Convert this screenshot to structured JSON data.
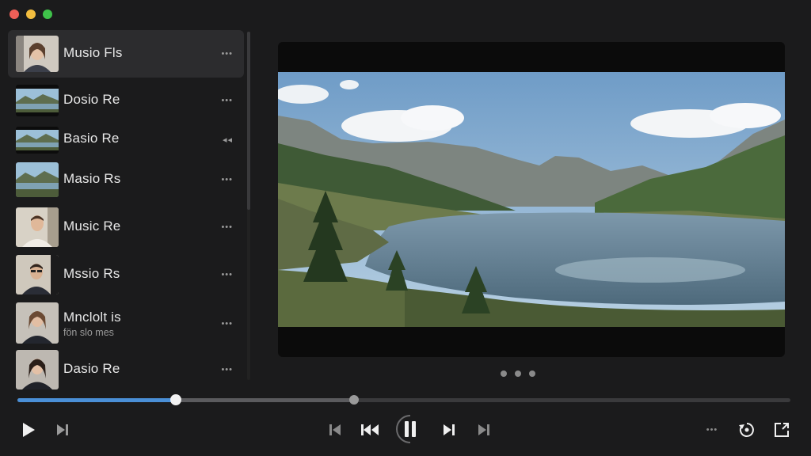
{
  "window": {
    "controls": [
      "close",
      "minimize",
      "zoom"
    ]
  },
  "playlist": {
    "items": [
      {
        "title": "Musio Fls",
        "subtitle": "",
        "action": "•••",
        "thumb": "portrait-woman",
        "active": true
      },
      {
        "title": "Dosio Re",
        "subtitle": "",
        "action": "•••",
        "thumb": "landscape-lake",
        "active": false
      },
      {
        "title": "Basio Re",
        "subtitle": "",
        "action": "◂◂",
        "thumb": "landscape-lake",
        "active": false
      },
      {
        "title": "Masio Rs",
        "subtitle": "",
        "action": "•••",
        "thumb": "landscape-lake",
        "active": false
      },
      {
        "title": "Music Re",
        "subtitle": "",
        "action": "•••",
        "thumb": "portrait-man",
        "active": false
      },
      {
        "title": "Mssio Rs",
        "subtitle": "",
        "action": "•••",
        "thumb": "portrait-man-glasses",
        "active": false
      },
      {
        "title": "Mnclolt is",
        "subtitle": "fön slo mes",
        "action": "•••",
        "thumb": "portrait-woman",
        "active": false
      },
      {
        "title": "Dasio Re",
        "subtitle": "",
        "action": "•••",
        "thumb": "portrait-woman",
        "active": false
      }
    ]
  },
  "player": {
    "scene": "mountain-lake-landscape",
    "page_dots": 3,
    "progress": {
      "played_fraction": 0.205,
      "buffered_fraction": 0.435
    },
    "controls": {
      "left": [
        "play-icon",
        "skip-next-icon"
      ],
      "center": [
        "skip-back-icon",
        "rewind-icon",
        "pause-icon",
        "next-track-icon",
        "skip-forward-icon"
      ],
      "right": [
        "more-icon",
        "replay-icon",
        "fullscreen-icon"
      ]
    },
    "more_label": "•••"
  },
  "colors": {
    "accent": "#4a8fd6",
    "background": "#1b1b1c",
    "active_row": "#2c2c2e"
  }
}
